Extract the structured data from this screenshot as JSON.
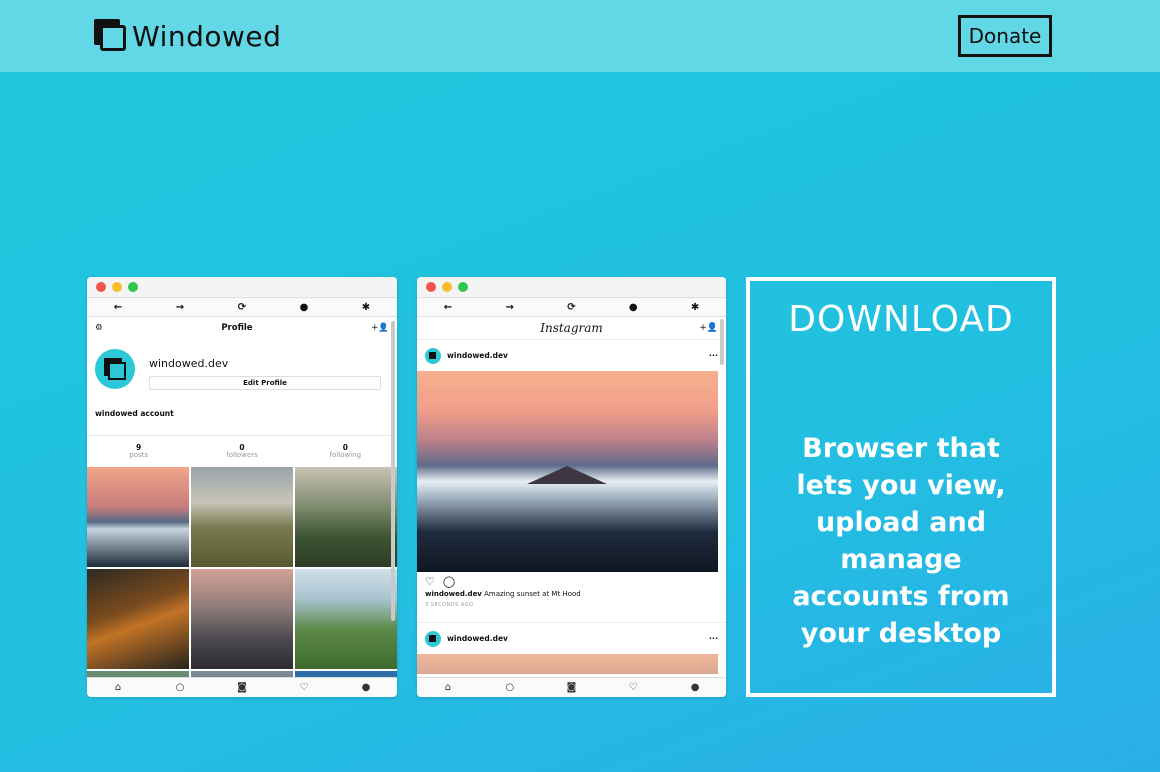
{
  "header": {
    "brand": "Windowed",
    "donate_label": "Donate"
  },
  "icons": {
    "back": "←",
    "forward": "→",
    "refresh": "⟳",
    "account": "●",
    "settings": "✱",
    "gear": "⚙",
    "add_user": "+👤",
    "home": "⌂",
    "search": "○",
    "camera": "◙",
    "heart": "♡",
    "profile": "●",
    "comment": "◯",
    "more": "···"
  },
  "profile_window": {
    "title": "Profile",
    "username": "windowed.dev",
    "edit_profile": "Edit Profile",
    "bio": "windowed account",
    "stats": [
      {
        "value": "9",
        "label": "posts"
      },
      {
        "value": "0",
        "label": "followers"
      },
      {
        "value": "0",
        "label": "following"
      }
    ]
  },
  "feed_window": {
    "title": "Instagram",
    "post1": {
      "user": "windowed.dev",
      "caption_user": "windowed.dev",
      "caption_text": "Amazing sunset at Mt Hood",
      "time": "3 SECONDS AGO"
    },
    "post2": {
      "user": "windowed.dev"
    }
  },
  "download": {
    "title": "DOWNLOAD",
    "text": "Browser that lets you view, upload and manage accounts from your desktop"
  }
}
